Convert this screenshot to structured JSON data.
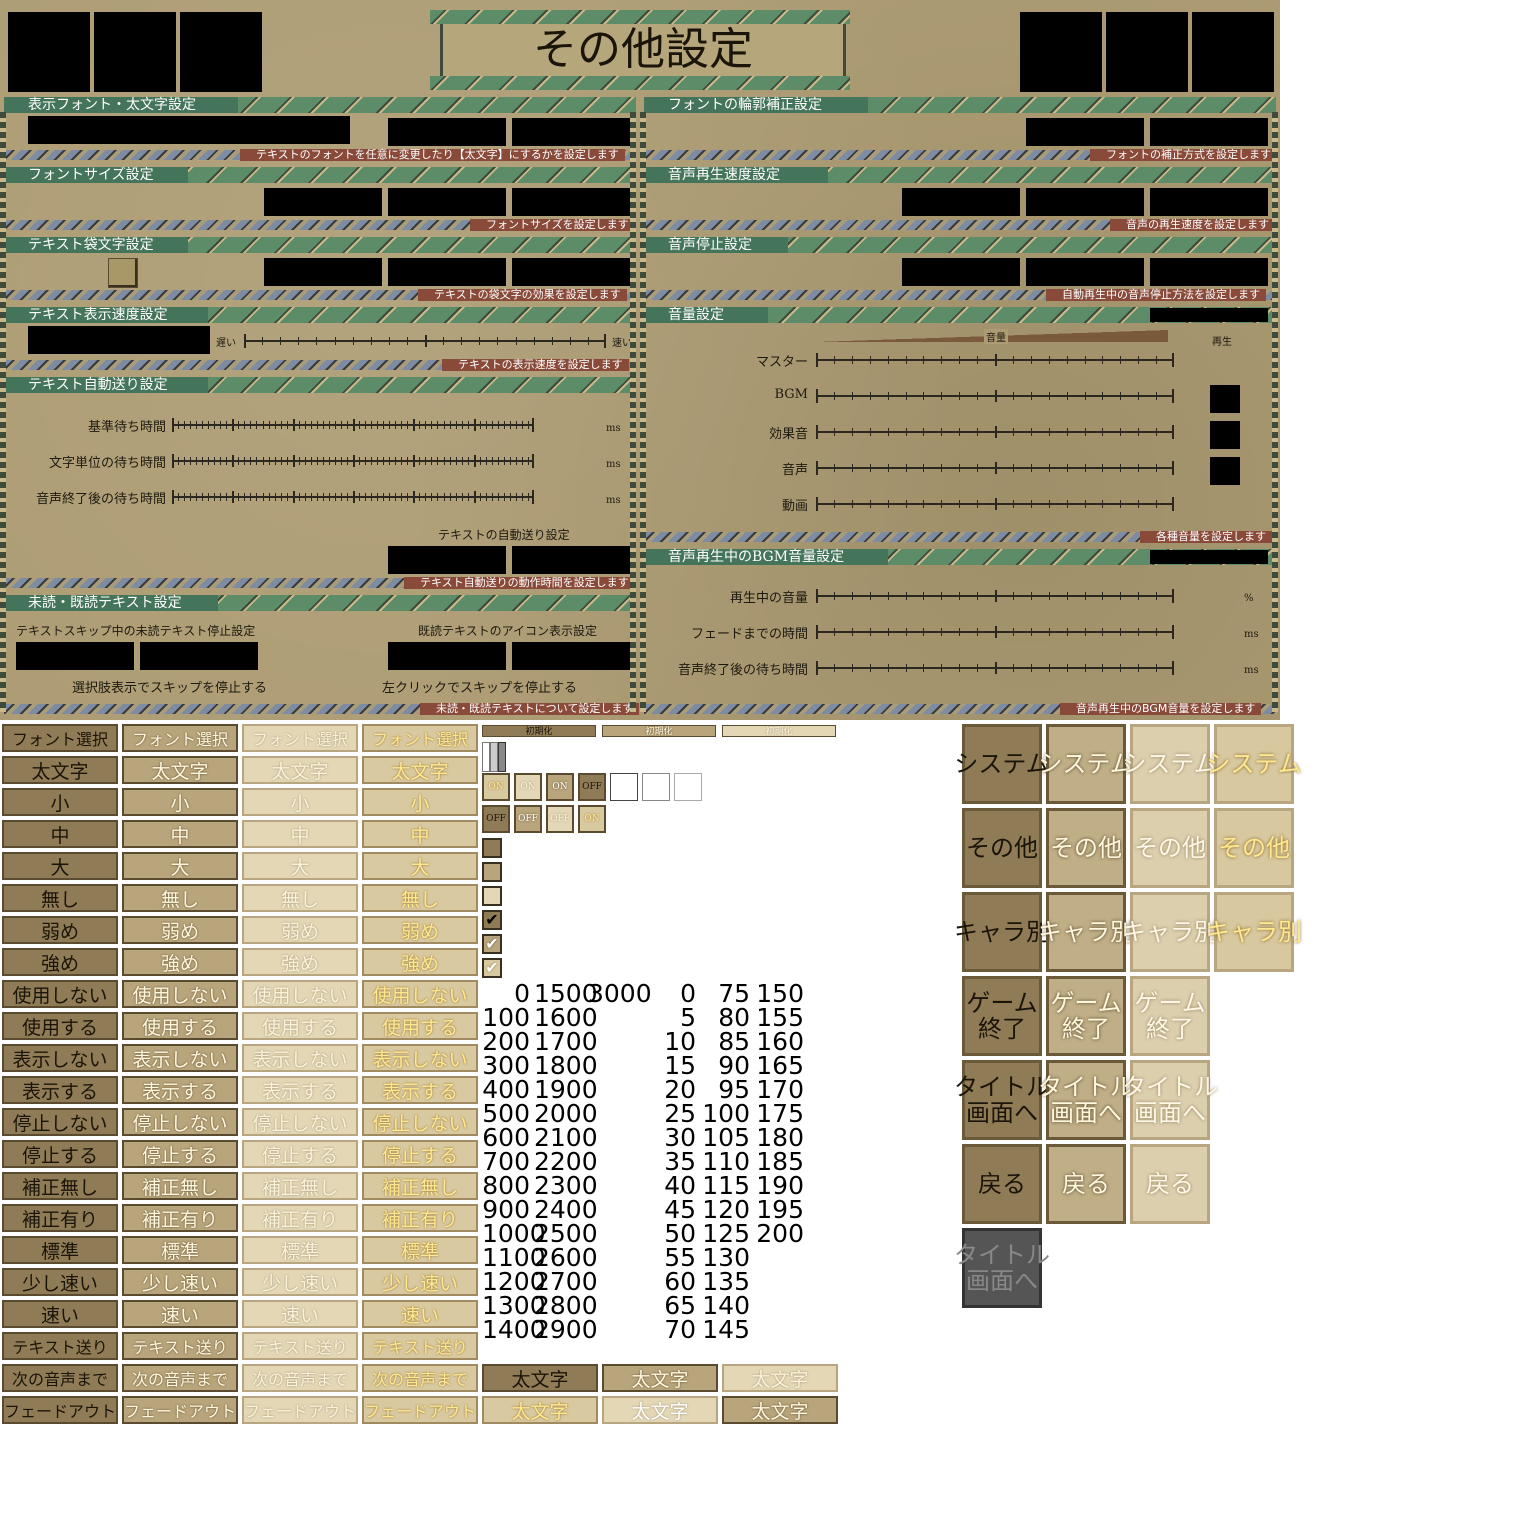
{
  "title": "その他設定",
  "sections": {
    "font": {
      "label": "表示フォント・太文字設定",
      "desc": "テキストのフォントを任意に変更したり【太文字】にするかを設定します"
    },
    "size": {
      "label": "フォントサイズ設定",
      "desc": "フォントサイズを設定します"
    },
    "outline": {
      "label": "テキスト袋文字設定",
      "desc": "テキストの袋文字の効果を設定します"
    },
    "speed": {
      "label": "テキスト表示速度設定",
      "desc": "テキストの表示速度を設定します",
      "slow": "遅い",
      "fast": "速い"
    },
    "auto": {
      "label": "テキスト自動送り設定",
      "desc": "テキスト自動送りの動作時間を設定します",
      "rows": [
        "基準待ち時間",
        "文字単位の待ち時間",
        "音声終了後の待ち時間"
      ],
      "unit": "ms",
      "mode_label": "テキストの自動送り設定"
    },
    "unread": {
      "label": "未読・既読テキスト設定",
      "desc": "未読・既読テキストについて設定します",
      "skip_label": "テキストスキップ中の未読テキスト停止設定",
      "icon_label": "既読テキストのアイコン表示設定",
      "choice_stop": "選択肢表示でスキップを停止する",
      "click_stop": "左クリックでスキップを停止する"
    },
    "correct": {
      "label": "フォントの輪郭補正設定",
      "desc": "フォントの補正方式を設定します"
    },
    "voice_speed": {
      "label": "音声再生速度設定",
      "desc": "音声の再生速度を設定します"
    },
    "voice_stop": {
      "label": "音声停止設定",
      "desc": "自動再生中の音声停止方法を設定します"
    },
    "volume": {
      "label": "音量設定",
      "desc": "各種音量を設定します",
      "vol_head": "音量",
      "play_head": "再生",
      "rows": [
        "マスター",
        "BGM",
        "効果音",
        "音声",
        "動画"
      ]
    },
    "bgm_duck": {
      "label": "音声再生中のBGM音量設定",
      "desc": "音声再生中のBGM音量を設定します",
      "rows": [
        "再生中の音量",
        "フェードまでの時間",
        "音声終了後の待ち時間"
      ],
      "units": [
        "%",
        "ms",
        "ms"
      ]
    }
  },
  "buttons": [
    "フォント選択",
    "太文字",
    "小",
    "中",
    "大",
    "無し",
    "弱め",
    "強め",
    "使用しない",
    "使用する",
    "表示しない",
    "表示する",
    "停止しない",
    "停止する",
    "補正無し",
    "補正有り",
    "標準",
    "少し速い",
    "速い",
    "テキスト送り",
    "次の音声まで",
    "フェードアウト"
  ],
  "init_label": "初期化",
  "on": "ON",
  "off": "OFF",
  "numbers": {
    "col1": [
      "0",
      "100",
      "200",
      "300",
      "400",
      "500",
      "600",
      "700",
      "800",
      "900",
      "1000",
      "1100",
      "1200",
      "1300",
      "1400"
    ],
    "col2": [
      "1500",
      "1600",
      "1700",
      "1800",
      "1900",
      "2000",
      "2100",
      "2200",
      "2300",
      "2400",
      "2500",
      "2600",
      "2700",
      "2800",
      "2900"
    ],
    "col3": [
      "3000"
    ],
    "col4": [
      "0",
      "5",
      "10",
      "15",
      "20",
      "25",
      "30",
      "35",
      "40",
      "45",
      "50",
      "55",
      "60",
      "65",
      "70"
    ],
    "col5": [
      "75",
      "80",
      "85",
      "90",
      "95",
      "100",
      "105",
      "110",
      "115",
      "120",
      "125",
      "130",
      "135",
      "140",
      "145"
    ],
    "col6": [
      "150",
      "155",
      "160",
      "165",
      "170",
      "175",
      "180",
      "185",
      "190",
      "195",
      "200"
    ]
  },
  "bold_btn": "太文字",
  "side_buttons": [
    "システム",
    "その他",
    "キャラ別",
    "ゲーム終了",
    "タイトル画面へ",
    "戻る"
  ],
  "side_rows": [
    [
      "システム",
      "システム",
      "システム",
      "システム"
    ],
    [
      "その他",
      "その他",
      "その他",
      "その他"
    ],
    [
      "キャラ別",
      "キャラ別",
      "キャラ別",
      "キャラ別"
    ],
    [
      "ゲーム\n終了",
      "ゲーム\n終了",
      "ゲーム\n終了"
    ],
    [
      "タイトル\n画面へ",
      "タイトル\n画面へ",
      "タイトル\n画面へ"
    ],
    [
      "戻る",
      "戻る",
      "戻る"
    ],
    [
      "タイトル\n画面へ"
    ]
  ],
  "colors": {
    "panel": "#ad9c73",
    "header": "#44745a",
    "desc_bg": "#8a4a3a"
  }
}
